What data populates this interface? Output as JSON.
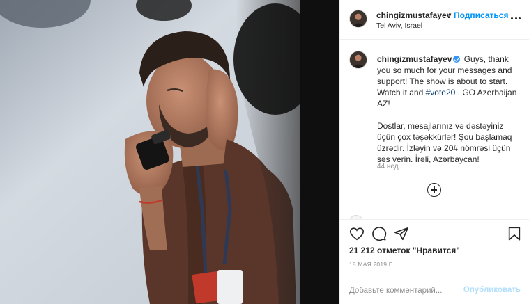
{
  "post": {
    "username": "chingizmustafayev",
    "follow_separator": "•",
    "follow_label": "Подписаться",
    "location": "Tel Aviv, Israel"
  },
  "caption": {
    "username": "chingizmustafayev",
    "text_before_tag": "Guys, thank you so much for your messages and support! The show is about to start. Watch it and",
    "hashtag": "#vote20",
    "text_after_tag": ". GO Azerbaijan AZ!",
    "paragraph_2": "Dostlar, mesajlarınız və dəstəyiniz üçün çox təşəkkürlər! Şou başlamaq üzrədir. İzləyin və 20# nömrəsi üçün səs verin. İrəli, Azərbaycan!",
    "time": "44 нед."
  },
  "stats": {
    "likes_count": "21 212",
    "likes_text": "отметок \"Нравится\"",
    "date": "18 МАЯ 2019 Г."
  },
  "comment_box": {
    "placeholder": "Добавьте комментарий...",
    "publish_label": "Опубликовать"
  },
  "icons": {
    "verified": "verified-badge-icon",
    "more": "more-options-icon",
    "load_more": "plus-circle-icon",
    "like": "heart-icon",
    "comment": "comment-icon",
    "share": "paper-plane-icon",
    "save": "bookmark-icon"
  },
  "colors": {
    "accent": "#0095f6",
    "verified": "#3897f0",
    "publish_disabled": "#b2dffc",
    "muted_text": "#8e8e8e"
  }
}
